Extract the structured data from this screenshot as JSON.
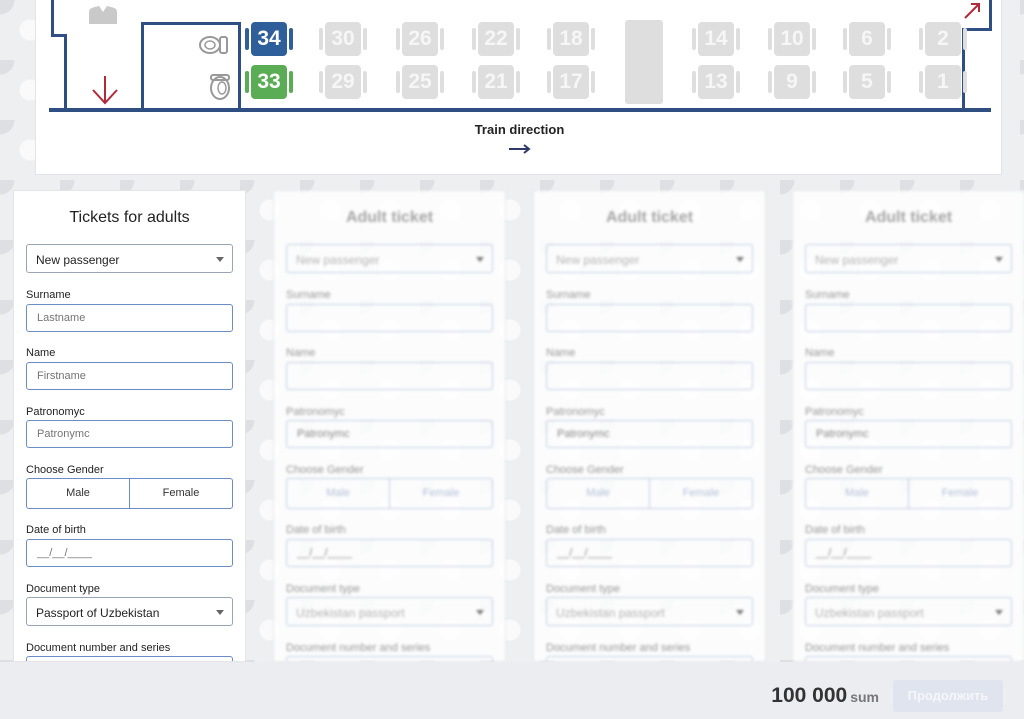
{
  "scheme": {
    "train_direction": "Train direction",
    "seats": [
      {
        "number": "34",
        "state": "blue",
        "col": 0,
        "row": "top"
      },
      {
        "number": "33",
        "state": "green",
        "col": 0,
        "row": "bottom"
      },
      {
        "number": "30",
        "state": "busy",
        "col": 1,
        "row": "top"
      },
      {
        "number": "29",
        "state": "busy",
        "col": 1,
        "row": "bottom"
      },
      {
        "number": "26",
        "state": "busy",
        "col": 2,
        "row": "top"
      },
      {
        "number": "25",
        "state": "busy",
        "col": 2,
        "row": "bottom"
      },
      {
        "number": "22",
        "state": "busy",
        "col": 3,
        "row": "top"
      },
      {
        "number": "21",
        "state": "busy",
        "col": 3,
        "row": "bottom"
      },
      {
        "number": "18",
        "state": "busy",
        "col": 4,
        "row": "top"
      },
      {
        "number": "17",
        "state": "busy",
        "col": 4,
        "row": "bottom"
      },
      {
        "number": "14",
        "state": "busy",
        "col": 6,
        "row": "top"
      },
      {
        "number": "13",
        "state": "busy",
        "col": 6,
        "row": "bottom"
      },
      {
        "number": "10",
        "state": "busy",
        "col": 7,
        "row": "top"
      },
      {
        "number": "9",
        "state": "busy",
        "col": 7,
        "row": "bottom"
      },
      {
        "number": "6",
        "state": "busy",
        "col": 8,
        "row": "top"
      },
      {
        "number": "5",
        "state": "busy",
        "col": 8,
        "row": "bottom"
      },
      {
        "number": "2",
        "state": "busy",
        "col": 9,
        "row": "top"
      },
      {
        "number": "1",
        "state": "busy",
        "col": 9,
        "row": "bottom"
      }
    ],
    "colors": {
      "wall": "#2f4f82",
      "seat_blue": "#2f5f9b",
      "seat_green": "#5aad54",
      "seat_busy": "#dedede",
      "exit_arrow": "#b02a3a"
    }
  },
  "forms": [
    {
      "title": "Tickets for adults",
      "passenger_select": "New passenger",
      "surname_label": "Surname",
      "surname_placeholder": "Lastname",
      "name_label": "Name",
      "name_placeholder": "Firstname",
      "patronymic_label": "Patronomyc",
      "patronymic_placeholder": "Patronymc",
      "gender_label": "Choose Gender",
      "gender_male": "Male",
      "gender_female": "Female",
      "dob_label": "Date of birth",
      "dob_placeholder": "__/__/____",
      "doc_type_label": "Document type",
      "doc_type_value": "Passport of Uzbekistan",
      "doc_number_label": "Document number and series"
    },
    {
      "title": "Adult ticket",
      "passenger_select": "New passenger",
      "surname_label": "Surname",
      "surname_placeholder": "",
      "name_label": "Name",
      "name_placeholder": "",
      "patronymic_label": "Patronomyc",
      "patronymic_placeholder": "Patronymc",
      "gender_label": "Choose Gender",
      "gender_male": "Male",
      "gender_female": "Female",
      "dob_label": "Date of birth",
      "dob_placeholder": "__/__/____",
      "doc_type_label": "Document type",
      "doc_type_value": "Uzbekistan passport",
      "doc_number_label": "Document number and series"
    },
    {
      "title": "Adult ticket",
      "passenger_select": "New passenger",
      "surname_label": "Surname",
      "surname_placeholder": "",
      "name_label": "Name",
      "name_placeholder": "",
      "patronymic_label": "Patronomyc",
      "patronymic_placeholder": "Patronymc",
      "gender_label": "Choose Gender",
      "gender_male": "Male",
      "gender_female": "Female",
      "dob_label": "Date of birth",
      "dob_placeholder": "__/__/____",
      "doc_type_label": "Document type",
      "doc_type_value": "Uzbekistan passport",
      "doc_number_label": "Document number and series"
    },
    {
      "title": "Adult ticket",
      "passenger_select": "New passenger",
      "surname_label": "Surname",
      "surname_placeholder": "",
      "name_label": "Name",
      "name_placeholder": "",
      "patronymic_label": "Patronomyc",
      "patronymic_placeholder": "Patronymc",
      "gender_label": "Choose Gender",
      "gender_male": "Male",
      "gender_female": "Female",
      "dob_label": "Date of birth",
      "dob_placeholder": "__/__/____",
      "doc_type_label": "Document type",
      "doc_type_value": "Uzbekistan passport",
      "doc_number_label": "Document number and series"
    }
  ],
  "footer": {
    "price": "100 000",
    "currency": "sum",
    "continue_label": "Продолжить"
  }
}
